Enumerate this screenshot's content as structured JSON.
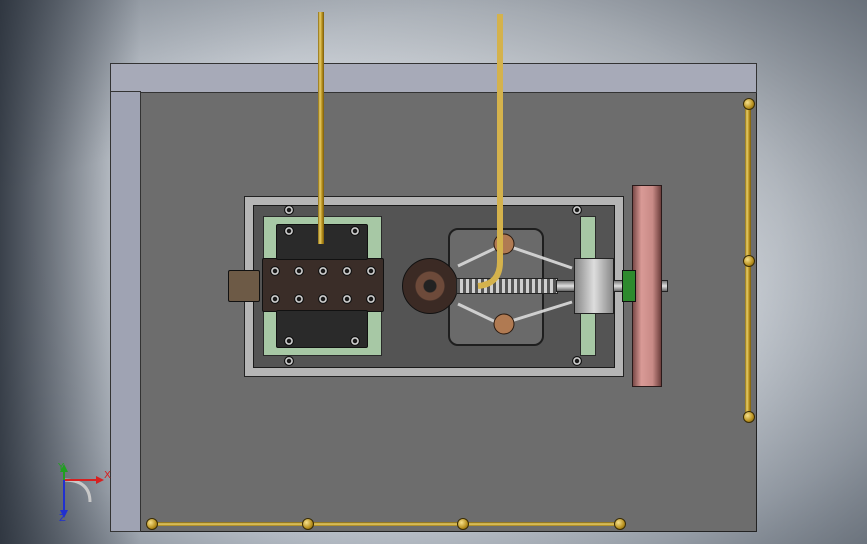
{
  "viewport": {
    "background": "#dfe4ea",
    "accent_brass": "#d4b24c",
    "accent_flywheel": "#d99a96",
    "accent_mount": "#a7c8a5"
  },
  "model": {
    "parts": [
      "base-plate",
      "engine-frame",
      "cylinder-block",
      "crank-disc",
      "lead-screw",
      "governor-bracket",
      "flywheel",
      "brass-pipes"
    ]
  },
  "triad": {
    "x_label": "X",
    "y_label": "Y",
    "z_label": "Z",
    "x_color": "#d62020",
    "y_color": "#20a020",
    "z_color": "#2030d0"
  }
}
